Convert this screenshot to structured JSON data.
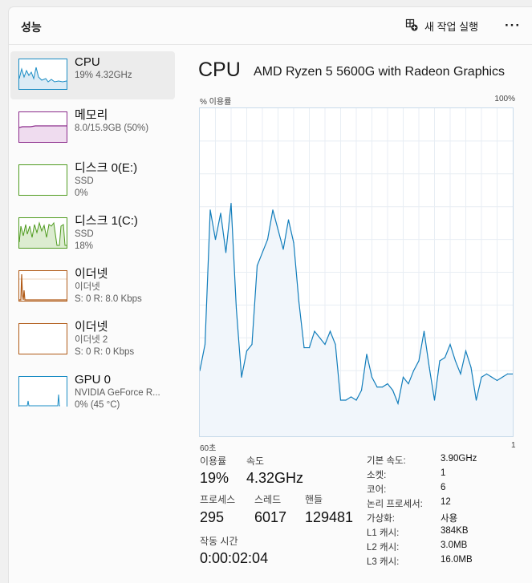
{
  "header": {
    "title": "성능",
    "run_task_label": "새 작업 실행",
    "more_label": "···"
  },
  "sidebar": {
    "items": [
      {
        "name": "CPU",
        "line1": "19% 4.32GHz",
        "line2": "",
        "color": "#1a8cc4"
      },
      {
        "name": "메모리",
        "line1": "8.0/15.9GB (50%)",
        "line2": "",
        "color": "#8b2a8b"
      },
      {
        "name": "디스크 0(E:)",
        "line1": "SSD",
        "line2": "0%",
        "color": "#4f9b1f"
      },
      {
        "name": "디스크 1(C:)",
        "line1": "SSD",
        "line2": "18%",
        "color": "#4f9b1f"
      },
      {
        "name": "이더넷",
        "line1": "이더넷",
        "line2": "S: 0 R: 8.0 Kbps",
        "color": "#b05a16"
      },
      {
        "name": "이더넷",
        "line1": "이더넷 2",
        "line2": "S: 0 R: 0 Kbps",
        "color": "#b05a16"
      },
      {
        "name": "GPU 0",
        "line1": "NVIDIA GeForce R...",
        "line2": "0% (45 °C)",
        "color": "#1a8cc4"
      }
    ]
  },
  "main": {
    "title": "CPU",
    "model": "AMD Ryzen 5 5600G with Radeon Graphics",
    "y_label": "% 이용률",
    "y_max_label": "100%",
    "x_left_label": "60초",
    "x_right_label": "1"
  },
  "chart_data": {
    "type": "area",
    "title": "CPU",
    "ylabel": "% 이용률",
    "xlabel": "",
    "ylim": [
      0,
      100
    ],
    "xlim": [
      60,
      0
    ],
    "grid": true,
    "color": "#117dbb",
    "x": [
      60,
      59,
      58,
      57,
      56,
      55,
      54,
      53,
      52,
      51,
      50,
      49,
      48,
      47,
      46,
      45,
      44,
      43,
      42,
      41,
      40,
      39,
      38,
      37,
      36,
      35,
      34,
      33,
      32,
      31,
      30,
      29,
      28,
      27,
      26,
      25,
      24,
      23,
      22,
      21,
      20,
      19,
      18,
      17,
      16,
      15,
      14,
      13,
      12,
      11,
      10,
      9,
      8,
      7,
      6,
      5,
      4,
      3,
      2,
      1,
      0
    ],
    "values": [
      20,
      28,
      69,
      60,
      68,
      56,
      71,
      39,
      18,
      26,
      28,
      52,
      56,
      60,
      69,
      63,
      57,
      66,
      59,
      41,
      27,
      27,
      32,
      30,
      28,
      32,
      28,
      11,
      11,
      12,
      11,
      14,
      25,
      18,
      15,
      15,
      16,
      14,
      10,
      18,
      16,
      20,
      23,
      32,
      21,
      11,
      23,
      24,
      28,
      23,
      19,
      26,
      21,
      11,
      18,
      19,
      18,
      17,
      18,
      19,
      19
    ]
  },
  "stats": {
    "util_label": "이용률",
    "util_value": "19%",
    "speed_label": "속도",
    "speed_value": "4.32GHz",
    "proc_label": "프로세스",
    "proc_value": "295",
    "thread_label": "스레드",
    "thread_value": "6017",
    "handle_label": "핸들",
    "handle_value": "129481",
    "uptime_label": "작동 시간",
    "uptime_value": "0:00:02:04"
  },
  "specs": [
    {
      "label": "기본 속도:",
      "value": "3.90GHz"
    },
    {
      "label": "소켓:",
      "value": "1"
    },
    {
      "label": "코어:",
      "value": "6"
    },
    {
      "label": "논리 프로세서:",
      "value": "12"
    },
    {
      "label": "가상화:",
      "value": "사용"
    },
    {
      "label": "L1 캐시:",
      "value": "384KB"
    },
    {
      "label": "L2 캐시:",
      "value": "3.0MB"
    },
    {
      "label": "L3 캐시:",
      "value": "16.0MB"
    }
  ]
}
